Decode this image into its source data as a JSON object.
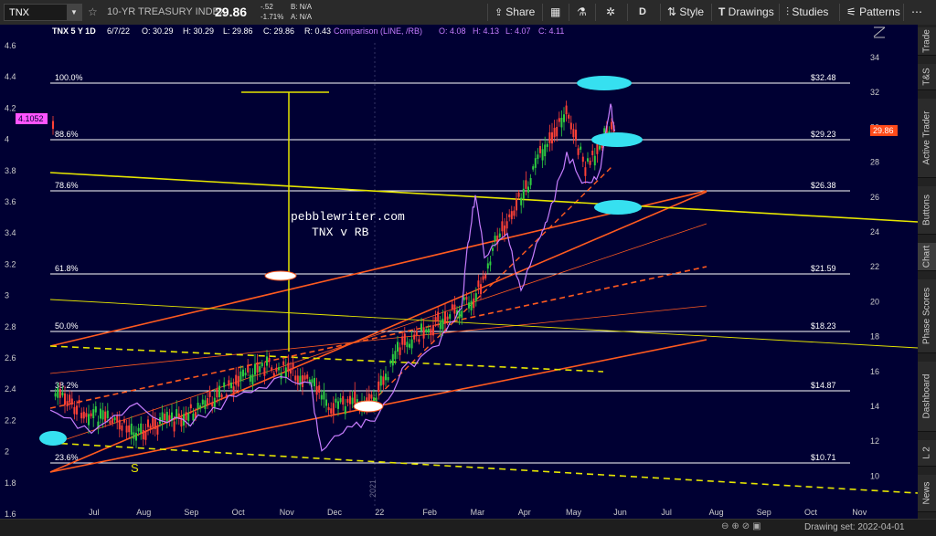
{
  "toolbar": {
    "symbol": "TNX",
    "name": "10-YR TREASURY INDEX",
    "last": "29.86",
    "change": "-.52",
    "change_pct": "-1.71%",
    "bid": "B: N/A",
    "ask": "A: N/A",
    "share": "Share",
    "period": "D",
    "style": "Style",
    "drawings": "Drawings",
    "studies": "Studies",
    "patterns": "Patterns"
  },
  "header": {
    "title": "TNX 5 Y 1D",
    "date": "6/7/22",
    "open": "O: 30.29",
    "high": "H: 30.29",
    "low": "L: 29.86",
    "close": "C: 29.86",
    "range": "R: 0.43",
    "comparison": "Comparison (LINE, /RB)",
    "cmp_open": "O: 4.08",
    "cmp_high": "H: 4.13",
    "cmp_low": "L: 4.07",
    "cmp_close": "C: 4.11"
  },
  "annotation": {
    "line1": "pebblewriter.com",
    "line2": "TNX v RB",
    "s_label": "S",
    "year_label": "2021"
  },
  "price_labels": {
    "left_current": "4.1052",
    "right_current": "29.86"
  },
  "fib_levels": [
    {
      "pct": "100.0%",
      "value": "$32.48"
    },
    {
      "pct": "88.6%",
      "value": "$29.23"
    },
    {
      "pct": "78.6%",
      "value": "$26.38"
    },
    {
      "pct": "61.8%",
      "value": "$21.59"
    },
    {
      "pct": "50.0%",
      "value": "$18.23"
    },
    {
      "pct": "38.2%",
      "value": "$14.87"
    },
    {
      "pct": "23.6%",
      "value": "$10.71"
    }
  ],
  "left_axis": [
    "4.6",
    "4.4",
    "4.2",
    "4",
    "3.8",
    "3.6",
    "3.4",
    "3.2",
    "3",
    "2.8",
    "2.6",
    "2.4",
    "2.2",
    "2",
    "1.8",
    "1.6"
  ],
  "right_axis": [
    "34",
    "32",
    "30",
    "28",
    "26",
    "24",
    "22",
    "20",
    "18",
    "16",
    "14",
    "12",
    "10"
  ],
  "x_axis": [
    "Jul",
    "Aug",
    "Sep",
    "Oct",
    "Nov",
    "Dec",
    "22",
    "Feb",
    "Mar",
    "Apr",
    "May",
    "Jun",
    "Jul",
    "Aug",
    "Sep",
    "Oct",
    "Nov"
  ],
  "right_tabs": [
    "Trade",
    "T&S",
    "Active Trader",
    "Buttons",
    "Chart",
    "Phase Scores",
    "Dashboard",
    "L 2",
    "News"
  ],
  "footer": {
    "drawing_set": "Drawing set: 2022-04-01"
  },
  "colors": {
    "background": "#000033",
    "candle_up": "#2ecc40",
    "candle_down": "#ff4136",
    "comparison_line": "#c77dff",
    "channel": "#ff5a1f",
    "yellow": "#e6e600",
    "highlight": "#36e0f0"
  }
}
